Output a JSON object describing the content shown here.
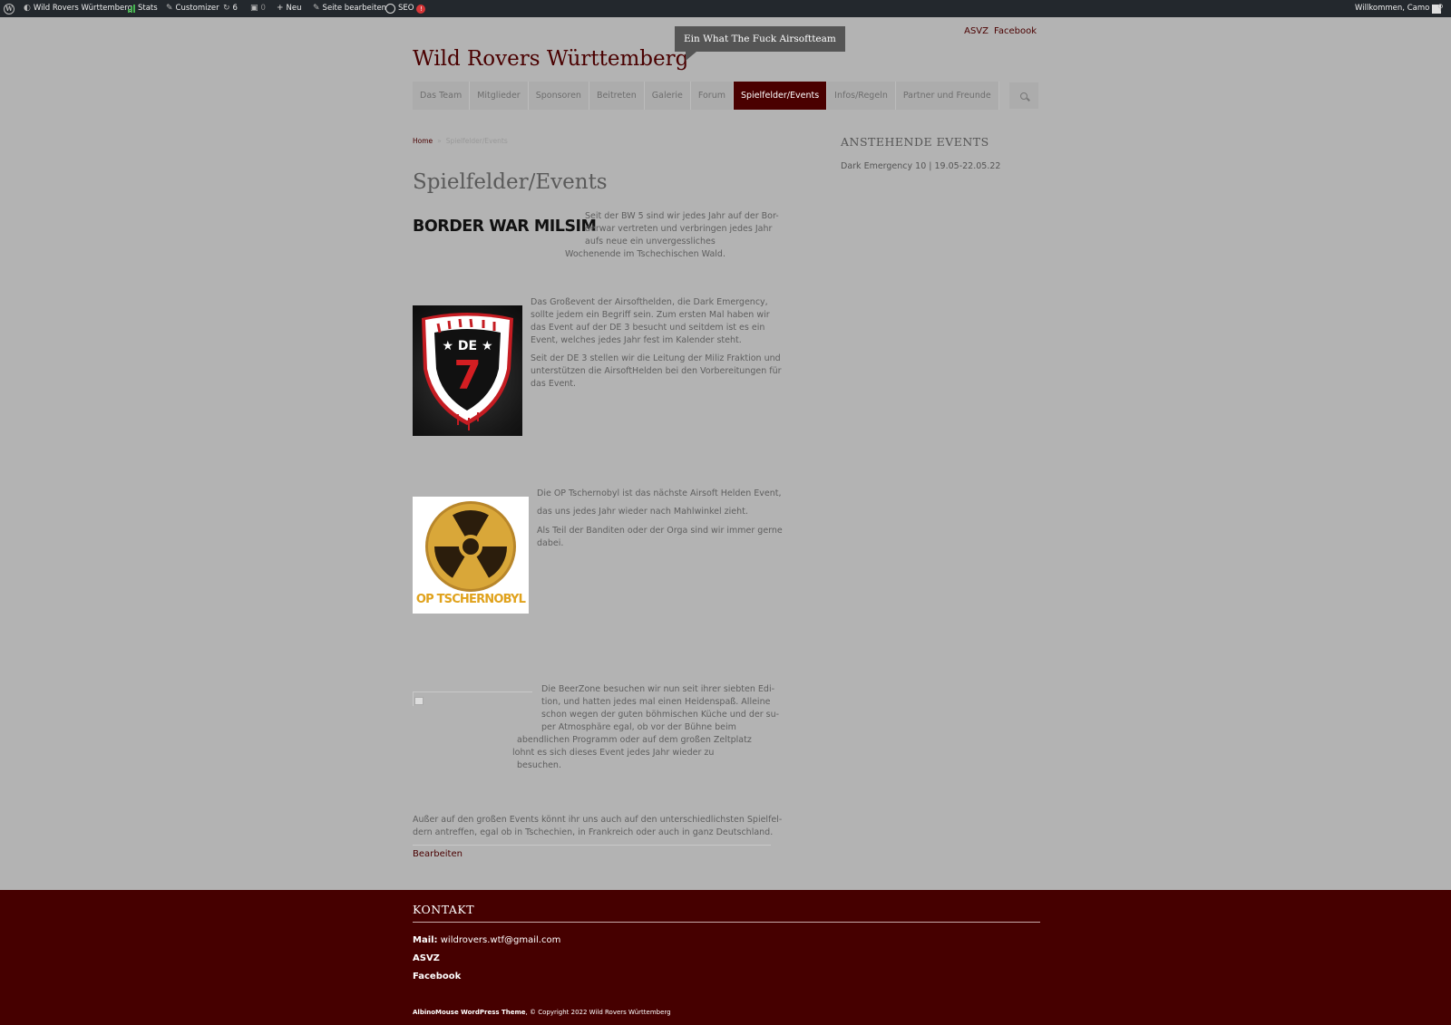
{
  "admin_bar": {
    "site_name": "Wild Rovers Württemberg",
    "stats": "Stats",
    "customizer": "Customizer",
    "updates_count": "6",
    "comments_count": "0",
    "new": "Neu",
    "edit_page": "Seite bearbeiten",
    "seo": "SEO",
    "seo_badge": "!",
    "welcome": "Willkommen, Camo"
  },
  "header": {
    "site_title": "Wild Rovers Württemberg",
    "tagline": "Ein What The Fuck Airsoftteam",
    "top_links": [
      "ASVZ",
      "Facebook"
    ]
  },
  "nav": {
    "items": [
      "Das Team",
      "Mitglieder",
      "Sponsoren",
      "Beitreten",
      "Galerie",
      "Forum",
      "Spielfelder/Events",
      "Infos/Regeln",
      "Partner und Freunde"
    ],
    "active": "Spielfelder/Events"
  },
  "breadcrumb": {
    "home": "Home",
    "sep": "»",
    "current": "Spielfelder/Events"
  },
  "page": {
    "title": "Spielfelder/Events",
    "bw_logo_text": "BORDER WAR MILSIM",
    "bw": {
      "l1": "Seit der BW 5 sind wir jedes Jahr auf der Bor-",
      "l2": "derwar vertreten und verbringen jedes Jahr",
      "l3": "aufs neue ein  unvergessliches",
      "l4": "Wochenende im Tschechischen Wald."
    },
    "de": {
      "l1": "Das Großevent der Airsofthelden, die Dark Emergency,",
      "l2": "sollte jedem ein Begriff sein. Zum ersten Mal haben wir",
      "l3": "das Event auf der DE 3 besucht und seitdem ist es ein",
      "l4": "Event, welches jedes Jahr fest im Kalender steht.",
      "l5": "Seit der DE 3 stellen wir die Leitung der Miliz Fraktion und",
      "l6": "unterstützen die AirsoftHelden bei den Vorbereitungen für",
      "l7": "das Event.",
      "shield_top": "DE",
      "shield_num": "7"
    },
    "op": {
      "l1": "Die OP Tschernobyl ist das nächste Airsoft Helden Event,",
      "l2": "das uns jedes Jahr wieder nach Mahlwinkel zieht.",
      "l3": "Als Teil der Banditen oder der Orga sind wir immer gerne",
      "l4": "dabei.",
      "logo_text": "OP TSCHERNOBYL"
    },
    "beer": {
      "l1": "Die BeerZone besuchen wir nun seit ihrer siebten Edi-",
      "l2": "tion,  und hatten jedes mal einen Heidenspaß. Alleine",
      "l3": "schon wegen der guten böhmischen Küche und der su-",
      "l4": "per Atmosphäre egal, ob vor der Bühne beim",
      "l5": "abendlichen Programm oder auf dem großen Zeltplatz",
      "l6": "lohnt es sich dieses Event jedes Jahr wieder zu",
      "l7": "besuchen."
    },
    "outro": {
      "l1": "Außer auf den großen Events könnt ihr uns auch auf den unterschiedlichsten Spielfel-",
      "l2": "dern antreffen, egal ob in Tschechien, in Frankreich oder auch in ganz Deutschland."
    },
    "edit_link": "Bearbeiten"
  },
  "sidebar": {
    "widget_title": "ANSTEHENDE EVENTS",
    "event": "Dark Emergency 10 | 19.05-22.05.22"
  },
  "footer": {
    "title": "KONTAKT",
    "mail_label": "Mail:",
    "mail": "wildrovers.wtf@gmail.com",
    "asvz": "ASVZ",
    "facebook": "Facebook",
    "theme": "AlbinoMouse WordPress Theme",
    "copyright": ", © Copyright 2022 Wild Rovers Württemberg"
  },
  "colors": {
    "brand": "#4a0000",
    "footer": "#460000",
    "page_bg": "#b3b3b3",
    "admin_bar": "#23282d"
  }
}
